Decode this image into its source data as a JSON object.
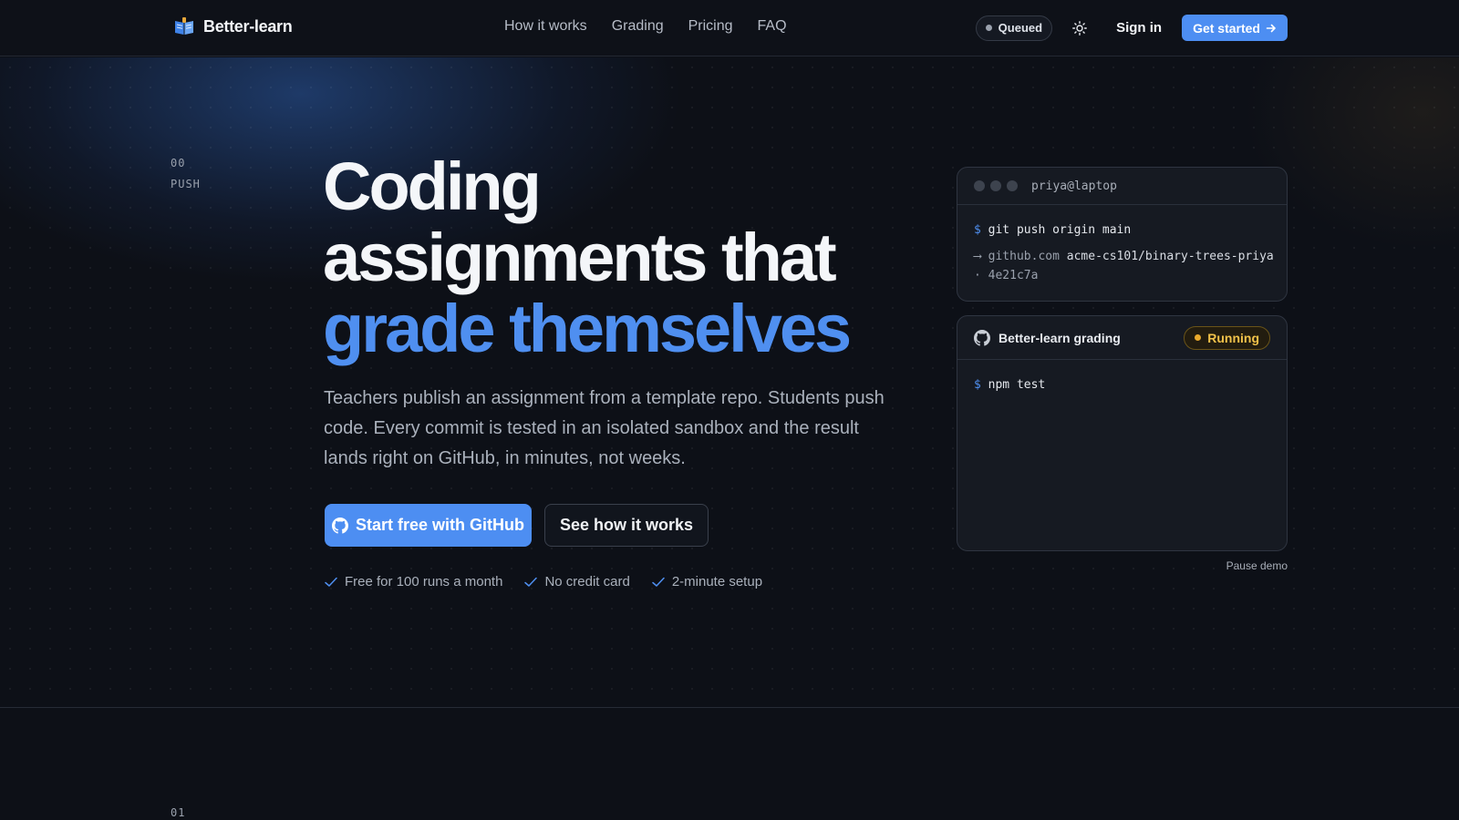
{
  "header": {
    "brand_name": "Better-learn",
    "nav": [
      "How it works",
      "Grading",
      "Pricing",
      "FAQ"
    ],
    "status_badge": "Queued",
    "sign_in": "Sign in",
    "get_started": "Get started"
  },
  "hero": {
    "step_number": "00",
    "step_label": "PUSH",
    "headline_line1": "Coding",
    "headline_line2": "assignments that",
    "headline_accent": "grade themselves",
    "lede": "Teachers publish an assignment from a template repo. Students push code. Every commit is tested in an isolated sandbox and the result lands right on GitHub, in minutes, not weeks.",
    "cta_primary": "Start free with GitHub",
    "cta_secondary": "See how it works",
    "perks": [
      "Free for 100 runs a month",
      "No credit card",
      "2-minute setup"
    ]
  },
  "terminal": {
    "title": "priya@laptop",
    "prompt": "$",
    "command": "git push origin main",
    "arrow": "⟶",
    "host": "github.com",
    "repo": "acme-cs101/binary-trees-priya",
    "separator": "·",
    "commit": "4e21c7a"
  },
  "grading": {
    "title": "Better-learn grading",
    "status": "Running",
    "prompt": "$",
    "command": "npm test"
  },
  "pause_demo": "Pause demo",
  "next_section_number": "01",
  "colors": {
    "accent": "#4d8ef2",
    "background": "#0d1017",
    "running": "#f2c24a"
  }
}
